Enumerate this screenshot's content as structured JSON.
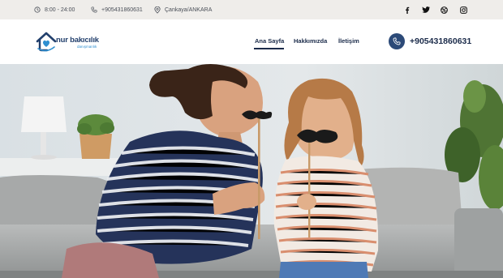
{
  "topbar": {
    "hours": "8:00 - 24:00",
    "phone": "+905431860631",
    "location": "Çankaya/ANKARA",
    "icons": {
      "hours": "clock-icon",
      "phone": "phone-icon",
      "location": "map-pin-icon"
    },
    "social": [
      "facebook-icon",
      "twitter-icon",
      "dribbble-icon",
      "instagram-icon"
    ]
  },
  "logo": {
    "title": "nur bakıcılık",
    "subtitle": "danışmanlık"
  },
  "nav": {
    "items": [
      {
        "label": "Ana Sayfa",
        "active": true
      },
      {
        "label": "Hakkımızda",
        "active": false
      },
      {
        "label": "İletişim",
        "active": false
      }
    ]
  },
  "header_phone": "+905431860631",
  "colors": {
    "brand_navy": "#1b2b4a",
    "phone_button": "#2c4a78",
    "topbar_bg": "#efedea",
    "logo_accent": "#2f8fd0"
  },
  "hero": {
    "image": "mother-and-daughter-with-paper-mustaches-on-sofa"
  }
}
